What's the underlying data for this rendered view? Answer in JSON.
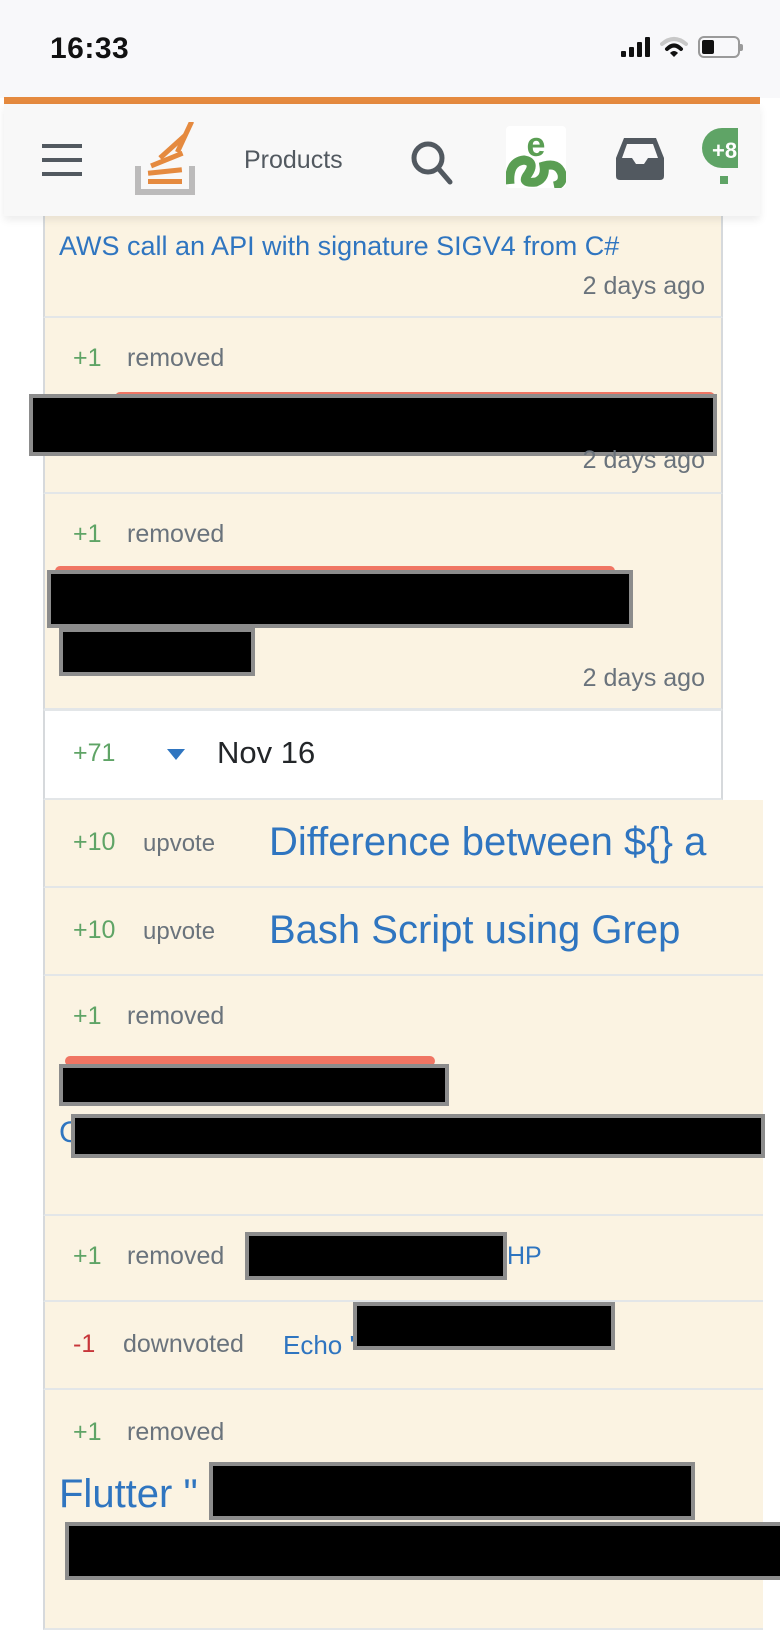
{
  "status_bar": {
    "time": "16:33",
    "signal_icon": "cellular-signal-icon",
    "wifi_icon": "wifi-icon",
    "battery_icon": "battery-icon",
    "battery_level_percent": 25
  },
  "topbar": {
    "menu_icon": "hamburger-menu-icon",
    "logo": "stack-overflow-logo",
    "products_label": "Products",
    "search_icon": "search-icon",
    "site_icon": "site-avatar-icon",
    "inbox_icon": "inbox-icon",
    "achievements_badge": "+8"
  },
  "feed": {
    "items": [
      {
        "title": "AWS call an API with signature SIGV4 from C#",
        "time": "2 days ago"
      },
      {
        "rep": "+1",
        "action": "removed",
        "time": "2 days ago"
      },
      {
        "rep": "+1",
        "action": "removed",
        "time": "2 days ago"
      },
      {
        "rep": "+71",
        "date": "Nov 16",
        "toggle_icon": "caret-down-icon"
      },
      {
        "rep": "+10",
        "action": "upvote",
        "title": "Difference between ${} a"
      },
      {
        "rep": "+10",
        "action": "upvote",
        "title": "Bash Script using Grep"
      },
      {
        "rep": "+1",
        "action": "removed",
        "title_prefix": "C"
      },
      {
        "rep": "+1",
        "action": "removed",
        "title_suffix": "HP"
      },
      {
        "rep": "-1",
        "action": "downvoted",
        "title_prefix": "Echo '"
      },
      {
        "rep": "+1",
        "action": "removed",
        "title_prefix": "Flutter \""
      }
    ]
  },
  "colors": {
    "accent_orange": "#e58a3f",
    "card_bg": "#fbf3e2",
    "link_blue": "#2f75c0",
    "rep_green": "#5fa466",
    "rep_red": "#c7363a",
    "muted_text": "#6a737c"
  }
}
